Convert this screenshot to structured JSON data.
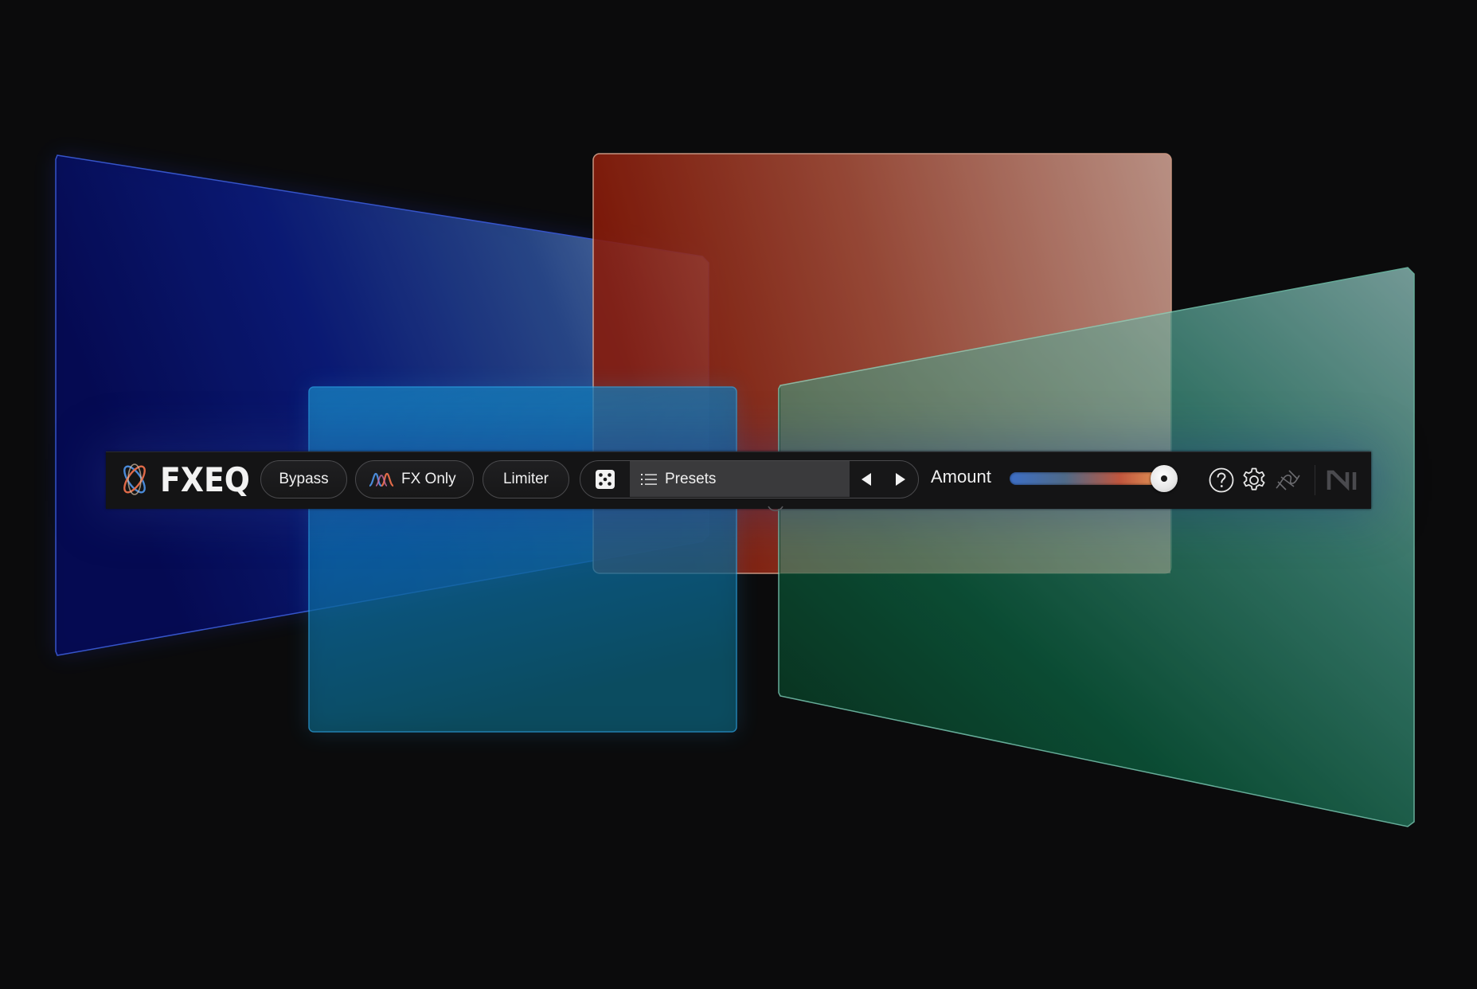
{
  "app": {
    "name": "FXEQ"
  },
  "toolbar": {
    "bypass_label": "Bypass",
    "fx_only_label": "FX Only",
    "limiter_label": "Limiter",
    "presets_label": "Presets",
    "amount_label": "Amount",
    "amount_value": 0.9
  },
  "icons": {
    "logo": "fxeq-orbit-logo",
    "fx_only": "spectrum-wave-icon",
    "random": "dice-icon",
    "presets": "list-icon",
    "prev": "triangle-left-icon",
    "next": "triangle-right-icon",
    "help": "question-circle-icon",
    "settings": "gear-icon",
    "link": "squiggle-link-icon",
    "vendor": "ni-logo"
  },
  "colors": {
    "background": "#0b0b0c",
    "toolbar": "#141415",
    "panel_blue": "#0a1a8c",
    "panel_red": "#8f2010",
    "panel_cyan": "#1a8ac0",
    "panel_green": "#0c5a3a",
    "slider_start": "#3d6fc6",
    "slider_end": "#e79f5a"
  }
}
